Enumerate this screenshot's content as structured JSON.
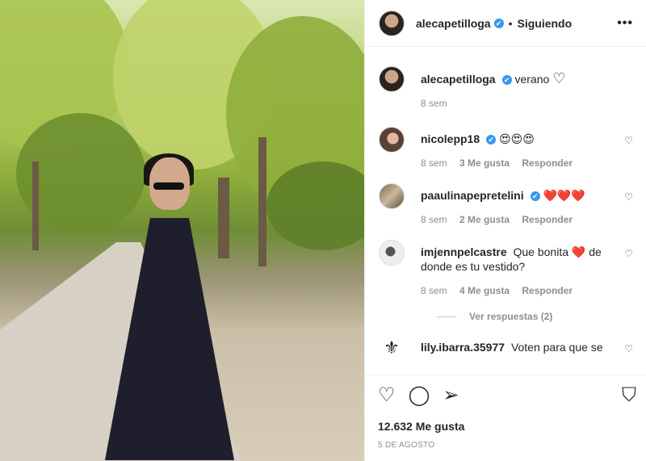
{
  "post": {
    "author": "alecapetilloga",
    "follow_dot": "•",
    "follow_label": "Siguiendo",
    "more_label": "•••"
  },
  "caption": {
    "user": "alecapetilloga",
    "text": "verano",
    "heart": "♡",
    "time": "8 sem"
  },
  "comments": [
    {
      "user": "nicolepp18",
      "verified": true,
      "text": "😍😍😍",
      "time": "8 sem",
      "likes": "3 Me gusta",
      "reply": "Responder"
    },
    {
      "user": "paaulinapepretelini",
      "verified": true,
      "text": "❤️❤️❤️",
      "time": "8 sem",
      "likes": "2 Me gusta",
      "reply": "Responder"
    },
    {
      "user": "imjennpelcastre",
      "verified": false,
      "text_a": "Que bonita",
      "text_heart": "❤️",
      "text_b": "de donde es tu vestido?",
      "time": "8 sem",
      "likes": "4 Me gusta",
      "reply": "Responder"
    },
    {
      "user": "lily.ibarra.35977",
      "verified": false,
      "text": "Voten para que se"
    }
  ],
  "replies_label": "Ver respuestas (2)",
  "icons": {
    "verified": "✔",
    "like": "♡",
    "comment": "◯",
    "share": "➢",
    "save": "⛉",
    "lily_avatar": "⚜"
  },
  "likes_count": "12.632 Me gusta",
  "date": "5 DE AGOSTO",
  "colors": {
    "verified": "#3897f0",
    "heart": "#ed4956",
    "muted": "#8e8e8e"
  }
}
